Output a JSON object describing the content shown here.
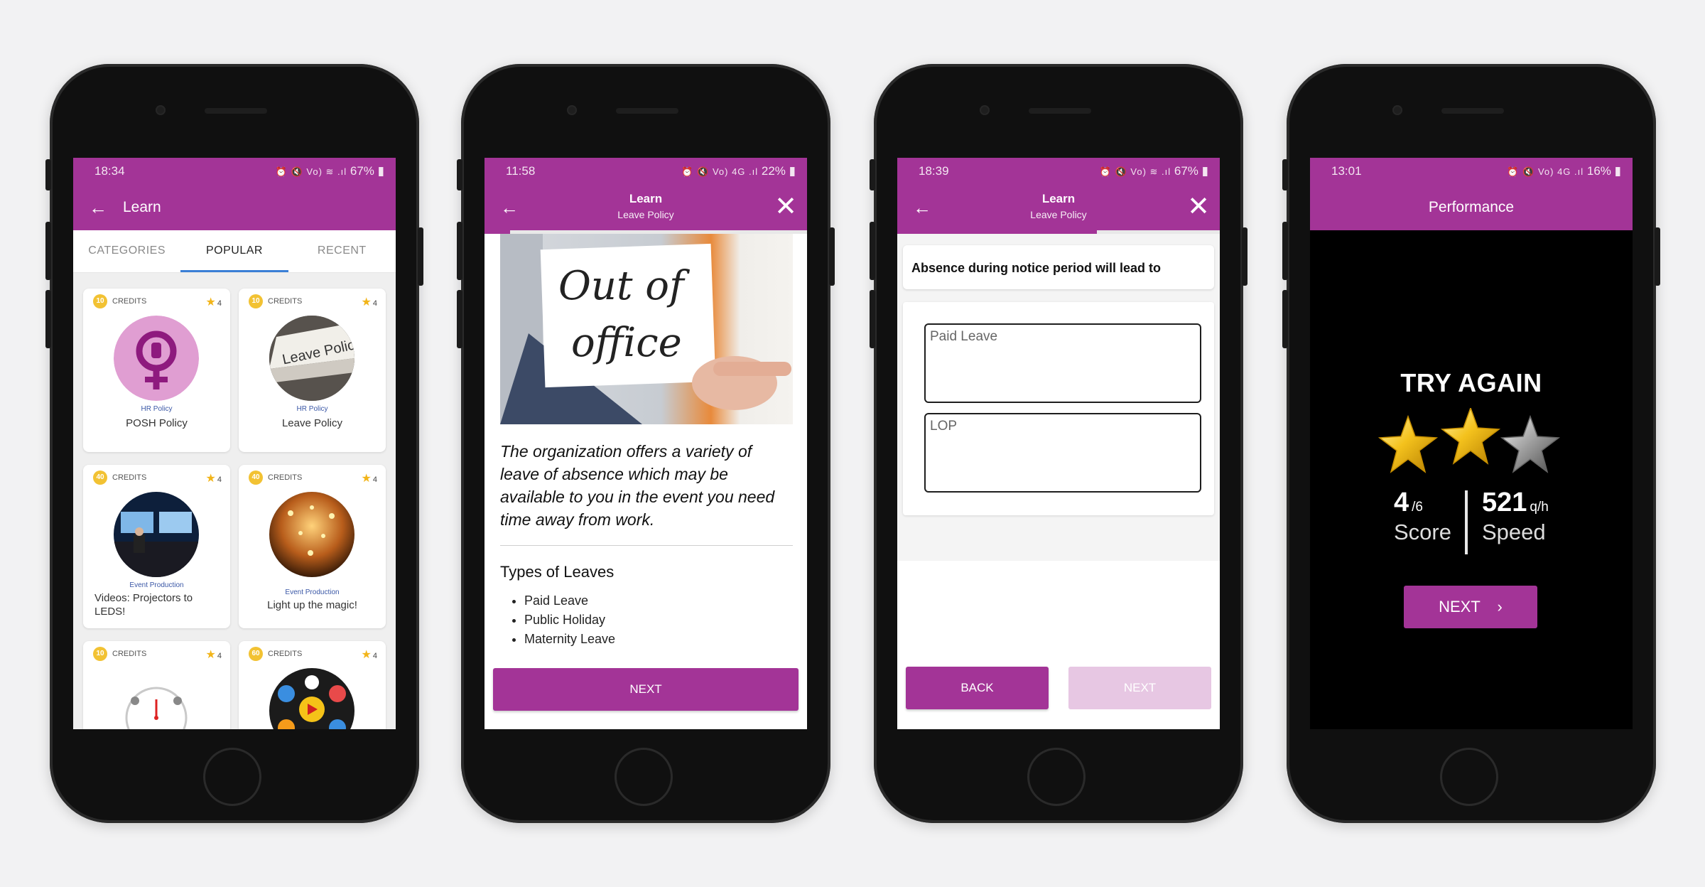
{
  "phone1": {
    "status": {
      "time": "18:34",
      "icons": "⏰ 🔇 Vo) ≋ .ıl",
      "battery": "67%"
    },
    "title": "Learn",
    "tabs": [
      "CATEGORIES",
      "POPULAR",
      "RECENT"
    ],
    "active_tab": "POPULAR",
    "credits_label": "CREDITS",
    "cards": [
      {
        "credits": "10",
        "rating": "4",
        "category": "HR Policy",
        "name": "POSH Policy"
      },
      {
        "credits": "10",
        "rating": "4",
        "category": "HR Policy",
        "name": "Leave Policy",
        "thumb_text": "Leave Policy"
      },
      {
        "credits": "40",
        "rating": "4",
        "category": "Event Production",
        "name": "Videos: Projectors to LEDS!"
      },
      {
        "credits": "40",
        "rating": "4",
        "category": "Event Production",
        "name": "Light up the magic!"
      },
      {
        "credits": "10",
        "rating": "4"
      },
      {
        "credits": "60",
        "rating": "4"
      }
    ]
  },
  "phone2": {
    "status": {
      "time": "11:58",
      "icons": "⏰ 🔇 Vo) 4G .ıl",
      "battery": "22%"
    },
    "title": "Learn",
    "subtitle": "Leave Policy",
    "progress": 0.08,
    "image_text": [
      "Out of",
      "office"
    ],
    "lead": "The organization offers a variety of leave of absence which may be available to you in the event you need time away from work.",
    "section_title": "Types of Leaves",
    "items": [
      "Paid Leave",
      "Public Holiday",
      "Maternity Leave"
    ],
    "next_label": "NEXT"
  },
  "phone3": {
    "status": {
      "time": "18:39",
      "icons": "⏰ 🔇 Vo) ≋ .ıl",
      "battery": "67%"
    },
    "title": "Learn",
    "subtitle": "Leave Policy",
    "progress": 0.62,
    "question": "Absence during notice period will lead to",
    "options": [
      "Paid Leave",
      "LOP"
    ],
    "back_label": "BACK",
    "next_label": "NEXT"
  },
  "phone4": {
    "status": {
      "time": "13:01",
      "icons": "⏰ 🔇 Vo) 4G .ıl",
      "battery": "16%"
    },
    "title": "Performance",
    "result": "TRY AGAIN",
    "stars_earned": 2,
    "stars_total": 3,
    "score": "4",
    "score_total": "/6",
    "score_label": "Score",
    "speed": "521",
    "speed_unit": "q/h",
    "speed_label": "Speed",
    "next_label": "NEXT",
    "next_icon": "chevron-right-icon"
  },
  "colors": {
    "brand": "#a33497",
    "brand_light": "#e7c7e3",
    "tab_indicator": "#3b7fd6",
    "coin": "#f2c233",
    "star": "#f2b51a"
  }
}
